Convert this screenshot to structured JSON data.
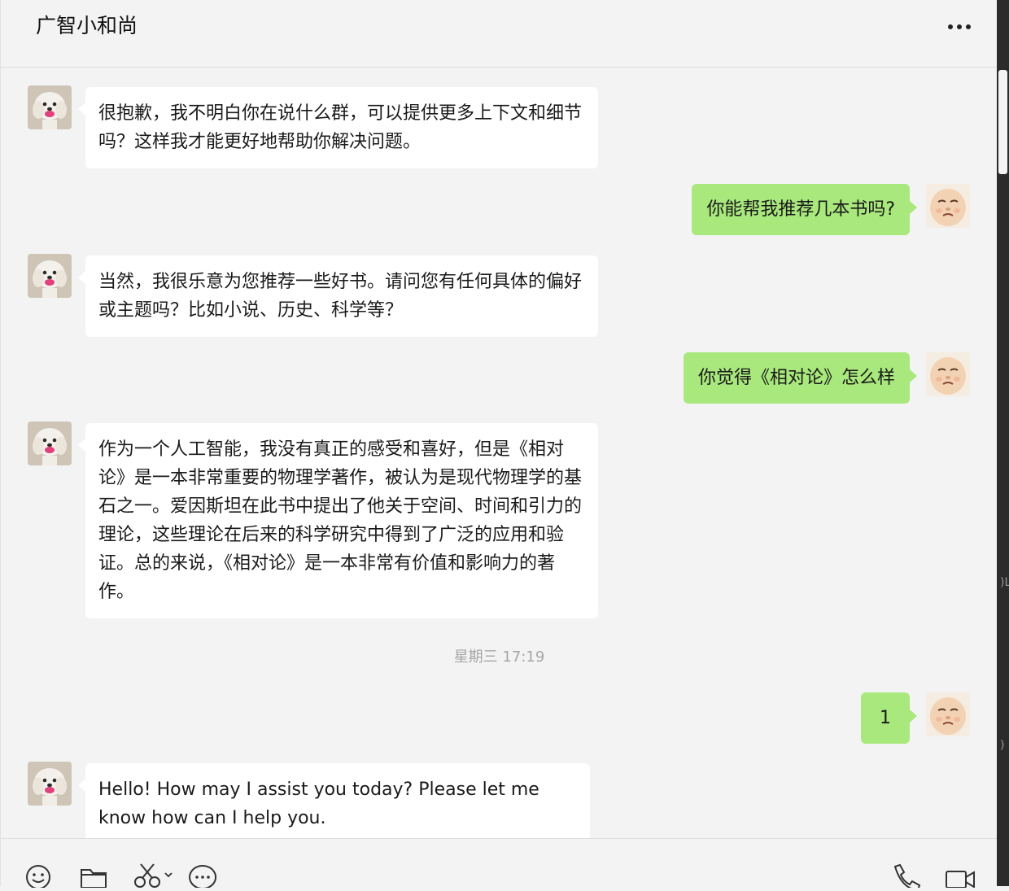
{
  "header": {
    "title": "广智小和尚",
    "more_icon": "more-horizontal-icon"
  },
  "messages": [
    {
      "sender": "bot",
      "text": "很抱歉，我不明白你在说什么群，可以提供更多上下文和细节吗？这样我才能更好地帮助你解决问题。"
    },
    {
      "sender": "user",
      "text": "你能帮我推荐几本书吗?"
    },
    {
      "sender": "bot",
      "text": "当然，我很乐意为您推荐一些好书。请问您有任何具体的偏好或主题吗？比如小说、历史、科学等？"
    },
    {
      "sender": "user",
      "text": "你觉得《相对论》怎么样"
    },
    {
      "sender": "bot",
      "text": "作为一个人工智能，我没有真正的感受和喜好，但是《相对论》是一本非常重要的物理学著作，被认为是现代物理学的基石之一。爱因斯坦在此书中提出了他关于空间、时间和引力的理论，这些理论在后来的科学研究中得到了广泛的应用和验证。总的来说，《相对论》是一本非常有价值和影响力的著作。"
    },
    {
      "sender": "user",
      "text": "1"
    },
    {
      "sender": "bot",
      "text": "Hello! How may I assist you today? Please let me know how can I help you."
    }
  ],
  "timestamp": "星期三 17:19",
  "toolbar": {
    "left_icons": [
      "emoji-icon",
      "folder-icon",
      "scissors-icon",
      "chat-bubble-icon"
    ],
    "right_icons": [
      "phone-icon",
      "video-call-icon"
    ]
  },
  "colors": {
    "background": "#f3f3f3",
    "incoming_bubble": "#ffffff",
    "outgoing_bubble": "#a8e87c",
    "timestamp_text": "#a6a6a6"
  }
}
